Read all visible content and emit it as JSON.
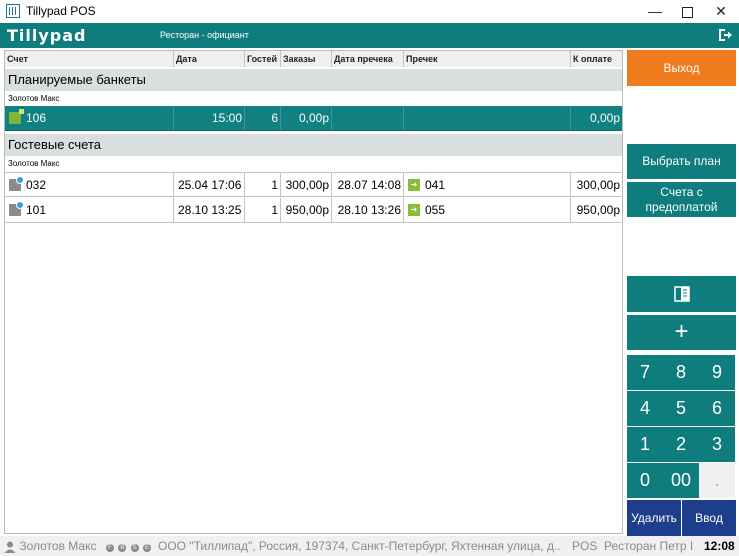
{
  "window": {
    "title": "Tillypad POS"
  },
  "header": {
    "logo": "Tillypad",
    "mode": "Ресторан - официант"
  },
  "table": {
    "columns": [
      "Счет",
      "Дата",
      "Гостей",
      "Заказы",
      "Дата пречека",
      "Пречек",
      "К оплате"
    ],
    "sections": [
      {
        "title": "Планируемые банкеты",
        "owner": "Золотов Макс",
        "rows": [
          {
            "account": "106",
            "date": "15:00",
            "guests": "6",
            "orders": "0,00р",
            "precheck_date": "",
            "precheck": "",
            "to_pay": "0,00р",
            "selected": true
          }
        ]
      },
      {
        "title": "Гостевые счета",
        "owner": "Золотов Макс",
        "rows": [
          {
            "account": "032",
            "date": "25.04 17:06",
            "guests": "1",
            "orders": "300,00р",
            "precheck_date": "28.07 14:08",
            "precheck": "041",
            "to_pay": "300,00р",
            "selected": false
          },
          {
            "account": "101",
            "date": "28.10 13:25",
            "guests": "1",
            "orders": "950,00р",
            "precheck_date": "28.10 13:26",
            "precheck": "055",
            "to_pay": "950,00р",
            "selected": false
          }
        ]
      }
    ]
  },
  "panel": {
    "exit_label": "Выход",
    "choose_plan_label": "Выбрать план",
    "prepaid_label": "Счета с предоплатой",
    "plus_label": "+",
    "keys": [
      "7",
      "8",
      "9",
      "4",
      "5",
      "6",
      "1",
      "2",
      "3",
      "0",
      "00",
      "."
    ],
    "delete_label": "Удалить",
    "enter_label": "Ввод"
  },
  "status": {
    "user": "Золотов Макс",
    "indicators": [
      "F",
      "B",
      "S",
      "E"
    ],
    "company": "ООО \"Тиллипад\", Россия, 197374, Санкт-Петербург, Яхтенная улица, д...",
    "terminal": "POS",
    "restaurant": "Ресторан Петр I",
    "time": "12:08"
  },
  "colors": {
    "teal": "#0f7d7d",
    "orange": "#f07c1e",
    "navy": "#1c3e8c",
    "section_bg": "#d9dedf"
  }
}
